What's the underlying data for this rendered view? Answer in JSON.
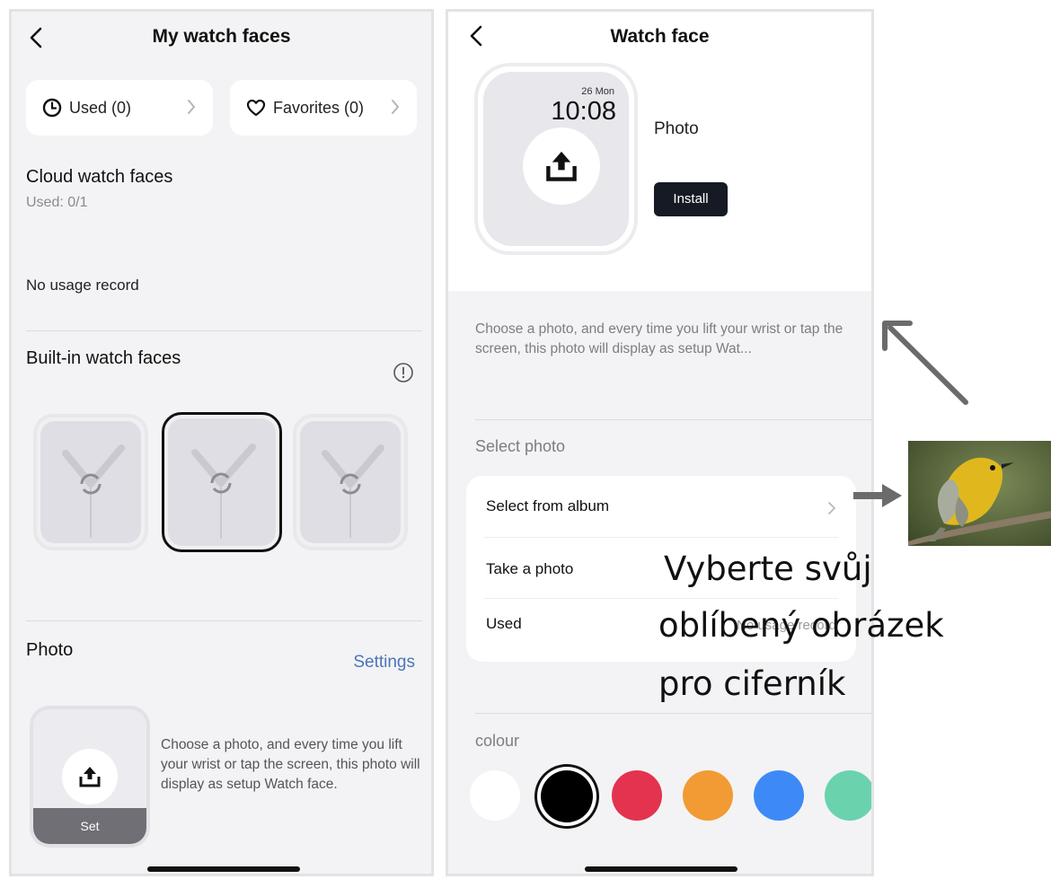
{
  "left": {
    "title": "My watch faces",
    "used_chip": "Used (0)",
    "favorites_chip": "Favorites (0)",
    "cloud": {
      "title": "Cloud watch faces",
      "used": "Used: 0/1"
    },
    "no_usage": "No usage record",
    "builtin_title": "Built-in watch faces",
    "photo": {
      "title": "Photo",
      "settings": "Settings",
      "set_label": "Set",
      "description": "Choose a photo, and every time you lift your wrist or tap the screen, this photo will display as setup Watch face."
    }
  },
  "right": {
    "title": "Watch face",
    "watch": {
      "date": "26 Mon",
      "time": "10:08"
    },
    "face_name": "Photo",
    "install": "Install",
    "description": "Choose a photo, and every time you lift your wrist or tap the screen, this photo will display as setup Wat...",
    "select_photo_title": "Select photo",
    "options": {
      "album": "Select from album",
      "take": "Take a photo",
      "used": "Used",
      "used_value": "No usage record"
    },
    "colour_title": "colour",
    "colours": [
      "#ffffff",
      "#000000",
      "#e3334f",
      "#f29b34",
      "#3d8af7",
      "#6ad3ae"
    ],
    "selected_colour": "#000000"
  },
  "overlay": {
    "line1": "Vyberte svůj",
    "line2": "oblíbený obrázek",
    "line3": "pro ciferník"
  },
  "icons": {
    "back": "chevron-left-icon",
    "clock": "clock-icon",
    "heart": "heart-icon",
    "info": "info-icon",
    "upload": "upload-icon",
    "sync": "sync-icon",
    "arrow_diag": "arrow-up-left-icon",
    "arrow_right": "arrow-right-icon"
  }
}
